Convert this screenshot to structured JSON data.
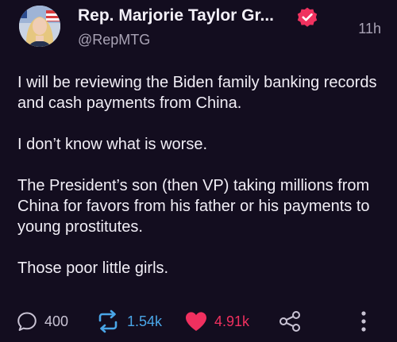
{
  "author": {
    "display_name": "Rep. Marjorie Taylor Gr...",
    "handle": "@RepMTG",
    "timestamp": "11h",
    "verified": true,
    "avatar_icon": "avatar-photo"
  },
  "tweet": {
    "paragraphs": [
      "I will be reviewing the Biden family banking records and cash payments from China.",
      "I don’t know what is worse.",
      "The President’s son (then VP) taking millions from China for favors from his father or his payments to young prostitutes.",
      "Those poor little girls."
    ]
  },
  "actions": {
    "replies": "400",
    "reposts": "1.54k",
    "likes": "4.91k",
    "reply_icon": "reply-icon",
    "repost_icon": "repost-icon",
    "like_icon": "heart-icon",
    "share_icon": "share-icon",
    "more_icon": "more-options-icon"
  },
  "colors": {
    "background": "#130d1f",
    "text": "#f1eef6",
    "muted": "#a9a3b5",
    "like": "#f0305f",
    "repost": "#4aa6e8",
    "verified_badge": "#f0325f"
  }
}
